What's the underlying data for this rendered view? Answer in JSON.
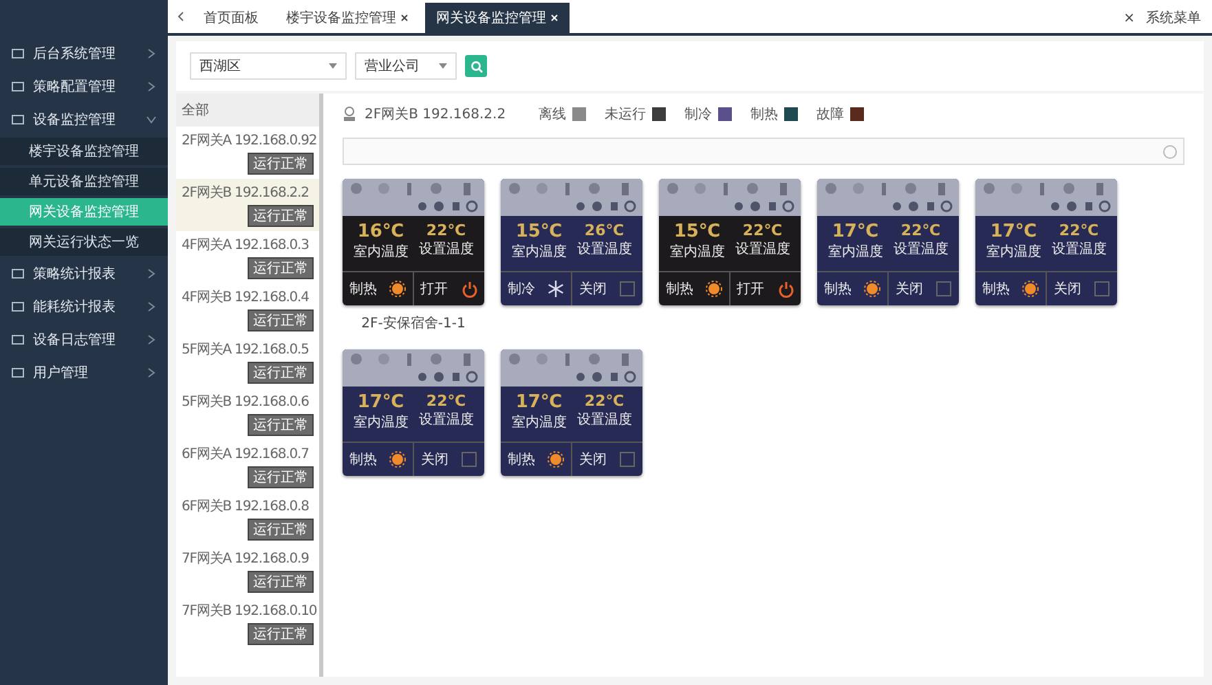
{
  "sidebar": {
    "items": [
      {
        "label": "后台系统管理",
        "expanded": false
      },
      {
        "label": "策略配置管理",
        "expanded": false
      },
      {
        "label": "设备监控管理",
        "expanded": true,
        "children": [
          {
            "label": "楼宇设备监控管理",
            "selected": false
          },
          {
            "label": "单元设备监控管理",
            "selected": false
          },
          {
            "label": "网关设备监控管理",
            "selected": true
          },
          {
            "label": "网关运行状态一览",
            "selected": false
          }
        ]
      },
      {
        "label": "策略统计报表",
        "expanded": false
      },
      {
        "label": "能耗统计报表",
        "expanded": false
      },
      {
        "label": "设备日志管理",
        "expanded": false
      },
      {
        "label": "用户管理",
        "expanded": false
      }
    ]
  },
  "tabs": [
    {
      "label": "首页面板",
      "selected": false,
      "closable": false
    },
    {
      "label": "楼宇设备监控管理",
      "selected": false,
      "closable": true
    },
    {
      "label": "网关设备监控管理",
      "selected": true,
      "closable": true
    }
  ],
  "top_right": {
    "close": "×",
    "menu": "系统菜单"
  },
  "filters": {
    "district": "西湖区",
    "company": "营业公司"
  },
  "gateway_list": {
    "header": "全部",
    "items": [
      {
        "name": "2F网关A 192.168.0.92",
        "badge": "运行正常",
        "selected": false
      },
      {
        "name": "2F网关B 192.168.2.2",
        "badge": "运行正常",
        "selected": true
      },
      {
        "name": "4F网关A 192.168.0.3",
        "badge": "运行正常",
        "selected": false
      },
      {
        "name": "4F网关B 192.168.0.4",
        "badge": "运行正常",
        "selected": false
      },
      {
        "name": "5F网关A 192.168.0.5",
        "badge": "运行正常",
        "selected": false
      },
      {
        "name": "5F网关B 192.168.0.6",
        "badge": "运行正常",
        "selected": false
      },
      {
        "name": "6F网关A 192.168.0.7",
        "badge": "运行正常",
        "selected": false
      },
      {
        "name": "6F网关B 192.168.0.8",
        "badge": "运行正常",
        "selected": false
      },
      {
        "name": "7F网关A 192.168.0.9",
        "badge": "运行正常",
        "selected": false
      },
      {
        "name": "7F网关B 192.168.0.10",
        "badge": "运行正常",
        "selected": false
      }
    ]
  },
  "legend": {
    "gateway": "2F网关B 192.168.2.2",
    "items": [
      {
        "label": "离线",
        "color": "#8a8a8a"
      },
      {
        "label": "未运行",
        "color": "#3c3c3c"
      },
      {
        "label": "制冷",
        "color": "#5b4f8c"
      },
      {
        "label": "制热",
        "color": "#1f4a52"
      },
      {
        "label": "故障",
        "color": "#5a2a1c"
      }
    ]
  },
  "cards": [
    {
      "current_temp": "16℃",
      "current_label": "室内温度",
      "set_temp": "22℃",
      "set_label": "设置温度",
      "mode_label": "制热",
      "kind": "heat",
      "power_label": "打开",
      "on": true,
      "caption": "2F-安保宿舍-1-1"
    },
    {
      "current_temp": "15℃",
      "current_label": "室内温度",
      "set_temp": "26℃",
      "set_label": "设置温度",
      "mode_label": "制冷",
      "kind": "cool",
      "power_label": "关闭",
      "on": false
    },
    {
      "current_temp": "15℃",
      "current_label": "室内温度",
      "set_temp": "22℃",
      "set_label": "设置温度",
      "mode_label": "制热",
      "kind": "heat",
      "power_label": "打开",
      "on": true
    },
    {
      "current_temp": "17℃",
      "current_label": "室内温度",
      "set_temp": "22℃",
      "set_label": "设置温度",
      "mode_label": "制热",
      "kind": "heat",
      "power_label": "关闭",
      "on": false
    },
    {
      "current_temp": "17℃",
      "current_label": "室内温度",
      "set_temp": "22℃",
      "set_label": "设置温度",
      "mode_label": "制热",
      "kind": "heat",
      "power_label": "关闭",
      "on": false
    },
    {
      "current_temp": "17℃",
      "current_label": "室内温度",
      "set_temp": "22℃",
      "set_label": "设置温度",
      "mode_label": "制热",
      "kind": "heat",
      "power_label": "关闭",
      "on": false
    },
    {
      "current_temp": "17℃",
      "current_label": "室内温度",
      "set_temp": "22℃",
      "set_label": "设置温度",
      "mode_label": "制热",
      "kind": "heat",
      "power_label": "关闭",
      "on": false
    }
  ]
}
